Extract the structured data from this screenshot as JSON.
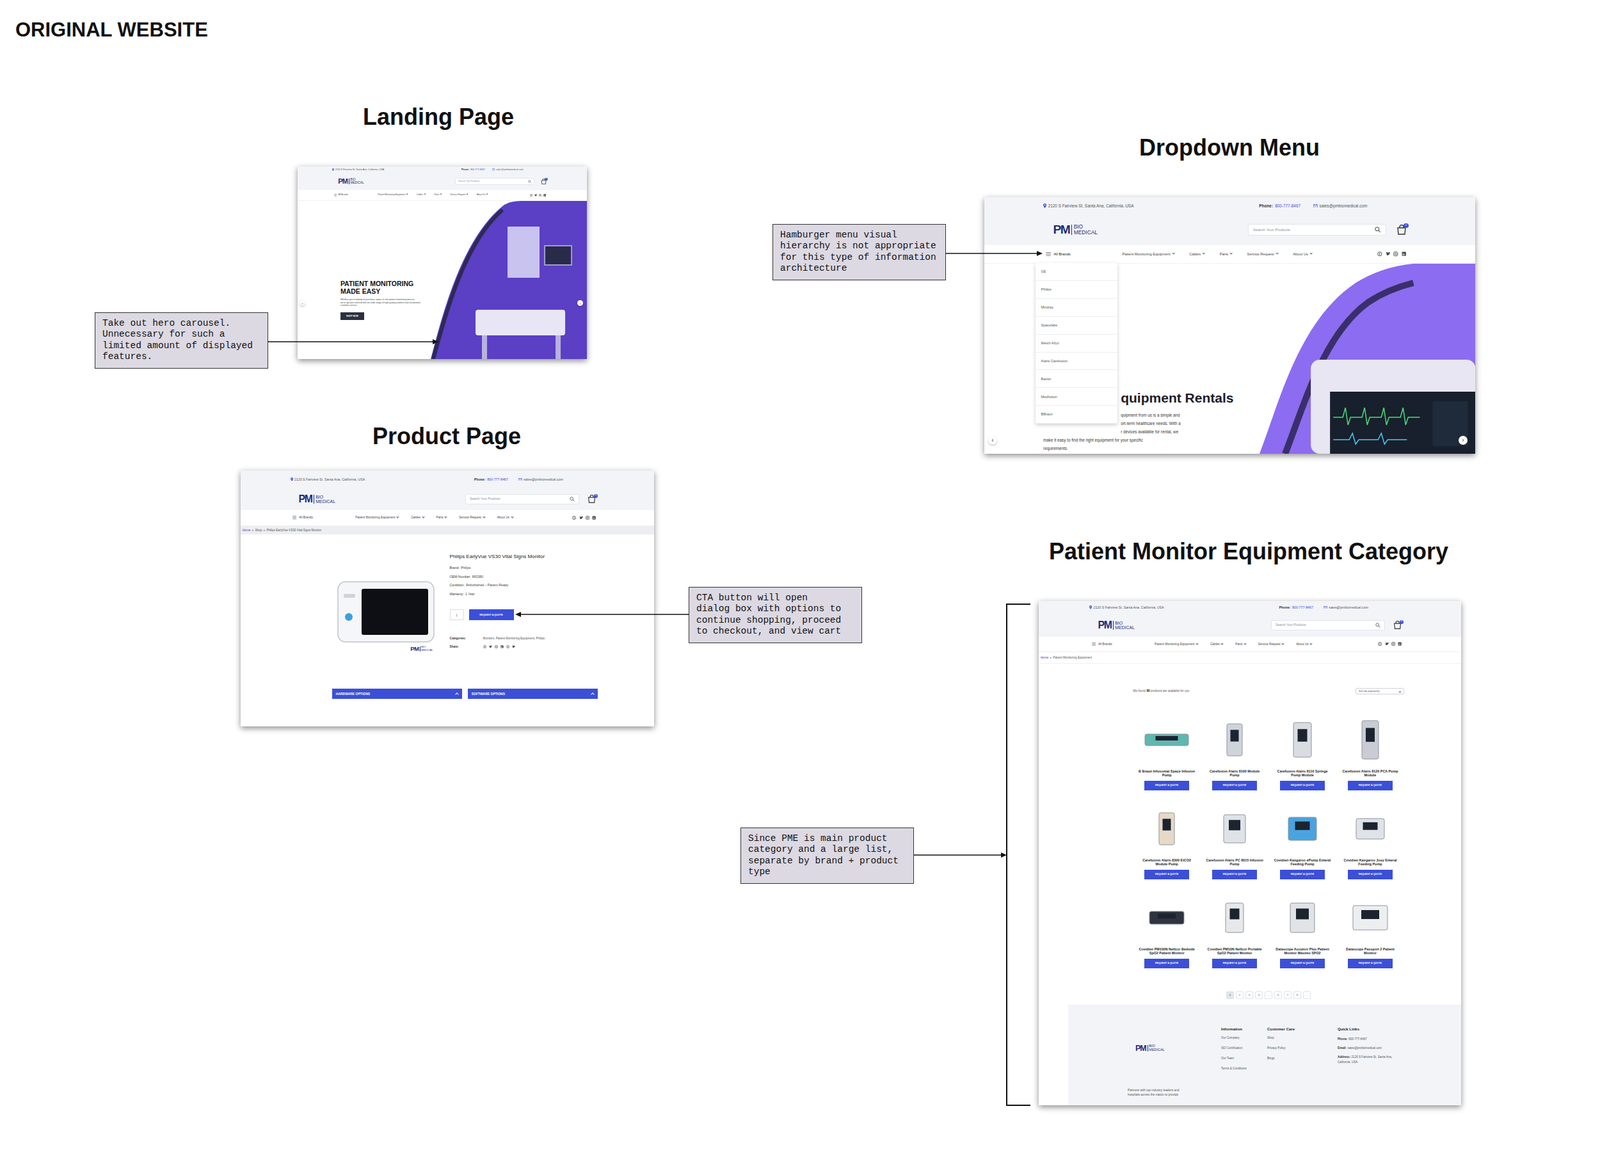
{
  "page_title": "ORIGINAL WEBSITE",
  "landing": {
    "heading": "Landing Page",
    "header": {
      "address": "2120 S Fairview St, Santa Ana, California, USA",
      "phone_label": "Phone:",
      "phone": "800-777-8467",
      "email": "sales@pmbiomedical.com",
      "logo": {
        "mark": "PM",
        "lines": [
          "BIO",
          "MEDICAL"
        ]
      },
      "search_placeholder": "Search Your Products",
      "cart_count": "0",
      "menu_label": "All Brands",
      "menu_open": false,
      "nav": [
        "Patient Monitoring Equipment",
        "Cables",
        "Parts",
        "Service Request",
        "About Us"
      ]
    },
    "hero": {
      "title_lines": [
        "PATIENT MONITORING",
        "MADE EASY"
      ],
      "text": "Whether you're looking to purchase, repair, or rent patient monitoring devices, we've got you covered with our wide range of high-quality products and exceptional customer service.",
      "button": "SHOP NOW",
      "prev": "‹",
      "next": "›"
    }
  },
  "dropdown": {
    "heading": "Dropdown Menu",
    "header": {
      "address": "2120 S Fairview St, Santa Ana, California, USA",
      "phone_label": "Phone:",
      "phone": "800-777-8467",
      "email": "sales@pmbiomedical.com",
      "logo": {
        "mark": "PM",
        "lines": [
          "BIO",
          "MEDICAL"
        ]
      },
      "search_placeholder": "Search Your Products",
      "cart_count": "0",
      "menu_label": "All Brands",
      "menu_open": true,
      "nav": [
        "Patient Monitoring Equipment",
        "Cables",
        "Parts",
        "Service Request",
        "About Us"
      ]
    },
    "brands": [
      "GE",
      "Philips",
      "Mindray",
      "Spacelabs",
      "Welch Allyn",
      "Alaris Carefusion",
      "Baxter",
      "Medfusion",
      "BBraun"
    ],
    "hero": {
      "title": "quipment Rentals",
      "lines_right": [
        "quipment from us is a simple and",
        "ort-term healthcare needs. With a",
        "r devices available for rental, we"
      ],
      "lines_left": [
        "make it easy to find the right equipment for your specific",
        "requirements."
      ],
      "prev": "‹",
      "next": "›"
    }
  },
  "product": {
    "heading": "Product Page",
    "header": {
      "address": "2120 S Fairview St, Santa Ana, California, USA",
      "phone_label": "Phone:",
      "phone": "800-777-8467",
      "email": "sales@pmbiomedical.com",
      "logo": {
        "mark": "PM",
        "lines": [
          "BIO",
          "MEDICAL"
        ]
      },
      "search_placeholder": "Search Your Products",
      "cart_count": "0",
      "menu_label": "All Brands",
      "menu_open": false,
      "nav": [
        "Patient Monitoring Equipment",
        "Cables",
        "Parts",
        "Service Request",
        "About Us"
      ]
    },
    "breadcrumb": {
      "separator": "»",
      "items": [
        "Home",
        "Shop",
        "Philips EarlyVue VS30 Vital Signs Monitor"
      ]
    },
    "image_logo": {
      "mark": "PM",
      "lines": [
        "BIO",
        "MEDICAL"
      ]
    },
    "title": "Philips EarlyVue VS30 Vital Signs Monitor",
    "specs": [
      {
        "label": "Brand:",
        "value": "Philips"
      },
      {
        "label": "OEM Number:",
        "value": "863380"
      },
      {
        "label": "Condition:",
        "value": "Refurbished – Patient Ready"
      },
      {
        "label": "Warranty:",
        "value": "1 Year"
      }
    ],
    "quantity": "1",
    "cta": "REQUEST A QUOTE",
    "categories_label": "Categories:",
    "categories": "Monitors, Patient Monitoring Equipment, Philips",
    "share_label": "Share:",
    "accordions": [
      "HARDWARE OPTIONS",
      "SOFTWARE OPTIONS"
    ]
  },
  "category": {
    "heading": "Patient Monitor Equipment Category",
    "header": {
      "address": "2120 S Fairview St, Santa Ana, California, USA",
      "phone_label": "Phone:",
      "phone": "800-777-8467",
      "email": "sales@pmbiomedical.com",
      "logo": {
        "mark": "PM",
        "lines": [
          "BIO",
          "MEDICAL"
        ]
      },
      "search_placeholder": "Search Your Products",
      "cart_count": "0",
      "menu_label": "All Brands",
      "menu_open": false,
      "nav": [
        "Patient Monitoring Equipment",
        "Cables",
        "Parts",
        "Service Request",
        "About Us"
      ]
    },
    "breadcrumb": {
      "separator": "»",
      "items": [
        "Home",
        "Patient Monitoring Equipment"
      ]
    },
    "found": {
      "pre": "We found",
      "count": "88",
      "post": "products are available for you"
    },
    "sort": "Sort by popularity",
    "products": [
      {
        "name": "B Braun Infusomat Space Infusion Pump",
        "cta": "REQUEST A QUOTE"
      },
      {
        "name": "Carefusion Alaris 8100 Module Pump",
        "cta": "REQUEST A QUOTE"
      },
      {
        "name": "Carefusion Alaris 8110 Syringe Pump Module",
        "cta": "REQUEST A QUOTE"
      },
      {
        "name": "Carefusion Alaris 8120 PCA Pump Module",
        "cta": "REQUEST A QUOTE"
      },
      {
        "name": "Carefusion Alaris 8300 EtCO2 Module Pump",
        "cta": "REQUEST A QUOTE"
      },
      {
        "name": "Carefusion Alaris PC 8015 Infusion Pump",
        "cta": "REQUEST A QUOTE"
      },
      {
        "name": "Covidien Kangaroo ePump Enteral Feeding Pump",
        "cta": "REQUEST A QUOTE"
      },
      {
        "name": "Covidien Kangaroo Joey Enteral Feeding Pump",
        "cta": "REQUEST A QUOTE"
      },
      {
        "name": "Covidien PM100N Nellcor Bedside SpO2 Patient Monitor",
        "cta": "REQUEST A QUOTE"
      },
      {
        "name": "Covidien PM10N Nellcor Portable SpO2 Patient Monitor",
        "cta": "REQUEST A QUOTE"
      },
      {
        "name": "Datascope Accutorr Plus Patient Monitor Masimo SPO2",
        "cta": "REQUEST A QUOTE"
      },
      {
        "name": "Datascope Passport 2 Patient Monitor",
        "cta": "REQUEST A QUOTE"
      }
    ],
    "pagination": [
      {
        "label": "1",
        "selected": true
      },
      {
        "label": "2",
        "selected": false
      },
      {
        "label": "3",
        "selected": false
      },
      {
        "label": "4",
        "selected": false
      },
      {
        "label": "…",
        "selected": false
      },
      {
        "label": "6",
        "selected": false
      },
      {
        "label": "7",
        "selected": false
      },
      {
        "label": "8",
        "selected": false
      },
      {
        "label": "→",
        "selected": false
      }
    ],
    "footer": {
      "logo": {
        "mark": "PM",
        "lines": [
          "BIO",
          "MEDICAL"
        ]
      },
      "columns": [
        {
          "title": "Information",
          "links": [
            "Our Company",
            "ISO Certification",
            "Our Team",
            "Terms & Conditions"
          ]
        },
        {
          "title": "Customer Care",
          "links": [
            "Shop",
            "Privacy Policy",
            "Blogs"
          ]
        }
      ],
      "quick_links": {
        "title": "Quick Links",
        "rows": [
          {
            "label": "Phone:",
            "value": "800-777-8467"
          },
          {
            "label": "Email:",
            "value": "sales@pmbiomedical.com"
          },
          {
            "label": "Address:",
            "value": "2120 S Fairview St, Santa Ana, California, USA"
          }
        ]
      },
      "about_lines": [
        "Partners with top industry leaders and",
        "hospitals across the nation to provide"
      ]
    }
  },
  "notes": [
    {
      "lines": [
        "Take out hero carousel.",
        "Unnecessary for such a",
        "limited amount of displayed",
        "features."
      ]
    },
    {
      "lines": [
        "Hamburger menu visual",
        "hierarchy is not appropriate",
        "for this type of information",
        "architecture"
      ]
    },
    {
      "lines": [
        "CTA button will open",
        "dialog box with options to",
        "continue shopping, proceed",
        "to checkout, and view cart"
      ]
    },
    {
      "lines": [
        "Since PME is main product",
        "category and a large list,",
        "separate by brand + product",
        "type"
      ]
    }
  ]
}
